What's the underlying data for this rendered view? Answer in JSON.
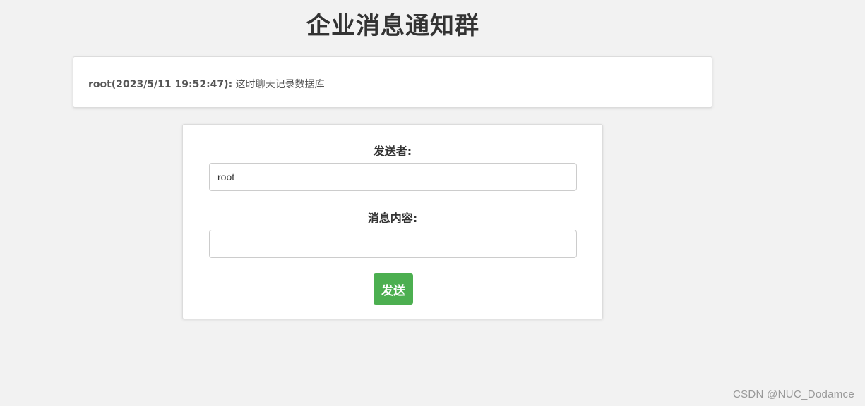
{
  "page": {
    "title": "企业消息通知群"
  },
  "messages": [
    {
      "sender_time": "root(2023/5/11 19:52:47):",
      "content": "这时聊天记录数据库"
    }
  ],
  "form": {
    "sender_label": "发送者:",
    "sender_value": "root",
    "content_label": "消息内容:",
    "content_value": "",
    "send_label": "发送"
  },
  "watermark": "CSDN @NUC_Dodamce",
  "colors": {
    "background": "#f2f2f2",
    "send_button": "#4caf50",
    "card": "#ffffff"
  }
}
